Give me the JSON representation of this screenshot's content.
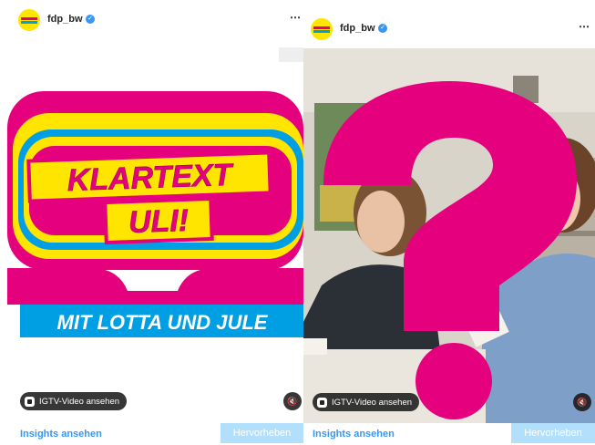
{
  "posts": [
    {
      "account": {
        "username": "fdp_bw",
        "verified": true
      },
      "overlay": {
        "igtv_label": "IGTV-Video ansehen"
      },
      "footer": {
        "insights_label": "Insights ansehen",
        "boost_label": "Hervorheben"
      },
      "artwork": {
        "line1": "KLARTEXT",
        "line2": "ULI!",
        "banner": "MIT LOTTA UND JULE"
      }
    },
    {
      "account": {
        "username": "fdp_bw",
        "verified": true
      },
      "overlay": {
        "igtv_label": "IGTV-Video ansehen"
      },
      "footer": {
        "insights_label": "Insights ansehen",
        "boost_label": "Hervorheben"
      },
      "artwork": {
        "symbol": "?"
      }
    }
  ],
  "icons": {
    "more": "⋯",
    "mute": "🔇",
    "verified": "✓"
  },
  "colors": {
    "brand_yellow": "#ffe500",
    "brand_magenta": "#e5007d",
    "brand_blue": "#009ee3",
    "link_blue": "#3897f0"
  }
}
